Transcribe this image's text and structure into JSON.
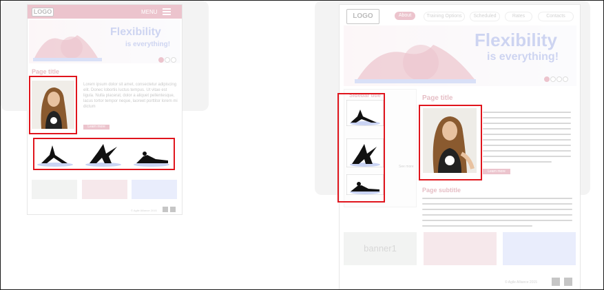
{
  "mobile": {
    "logo": "LOGO",
    "menu_label": "MENU",
    "hero_title": "Flexibility",
    "hero_subtitle": "is everything!",
    "page_title": "Page title",
    "body_text": "Lorem ipsum dolor sit amet, consectetur adipiscing elit. Donec lobortis luctus tempus. Ut vitae est ligula. Nulla placerat, dolor a aliquet pellentesque, lacus tortor tempor neque, laoreet porttitor lorem mi dictum",
    "learn_more": "Learn more",
    "footer_copyright": "© Agile Alliance 2015"
  },
  "desktop": {
    "logo": "LOGO",
    "nav": [
      "About",
      "Training Options",
      "Scheduled",
      "Rates",
      "Contacts"
    ],
    "hero_title": "Flexibility",
    "hero_subtitle": "is everything!",
    "sidebar_title": "Sidebar title",
    "see_more": "See more",
    "page_title": "Page title",
    "learn_more": "Learn more",
    "page_subtitle": "Page subtitle",
    "banner_label": "banner1",
    "footer_copyright": "© Agile Alliance 2015"
  },
  "colors": {
    "accent": "#c7506a",
    "hero_text": "#6b7fd6",
    "highlight": "#e0141c",
    "banner_grey": "#d9ddd8",
    "banner_pink": "#e6bcc4",
    "banner_blue": "#bfcaf7"
  }
}
